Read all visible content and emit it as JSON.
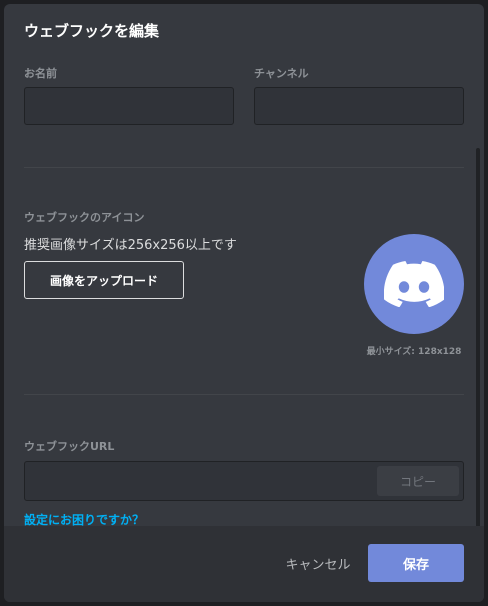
{
  "modal": {
    "title": "ウェブフックを編集"
  },
  "name_field": {
    "label": "お名前",
    "value": ""
  },
  "channel_field": {
    "label": "チャンネル",
    "value": ""
  },
  "icon_section": {
    "label": "ウェブフックのアイコン",
    "recommendation": "推奨画像サイズは256x256以上です",
    "upload_label": "画像をアップロード",
    "min_size": "最小サイズ: 128x128",
    "avatar_icon": "discord-logo-icon",
    "avatar_color": "#7289da"
  },
  "url_section": {
    "label": "ウェブフックURL",
    "value": "",
    "copy_label": "コピー"
  },
  "help_link": "設定にお困りですか？",
  "footer": {
    "cancel_label": "キャンセル",
    "save_label": "保存"
  },
  "colors": {
    "accent": "#7289da",
    "link": "#00b0f4",
    "background": "#36393f"
  }
}
